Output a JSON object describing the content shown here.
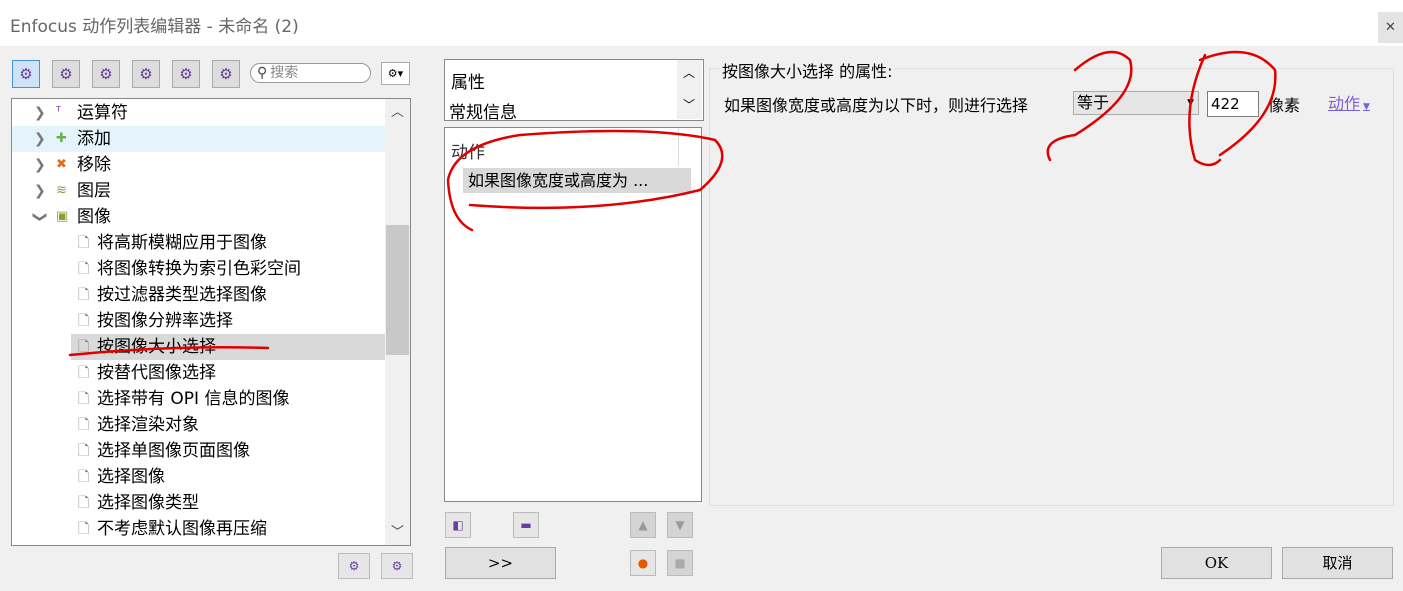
{
  "window": {
    "title": "Enfocus 动作列表编辑器 - 未命名 (2)",
    "close": "✕"
  },
  "toolbar": {
    "search_placeholder": "搜索",
    "icons": [
      "gear-all-icon",
      "gear-pointer-icon",
      "gear-refresh-icon",
      "gear-check-icon",
      "gear-info-icon",
      "gear-wrench-icon"
    ]
  },
  "tree": {
    "categories": [
      {
        "label": "运算符",
        "expanded": false,
        "icon_color": "#7a3d9a"
      },
      {
        "label": "添加",
        "expanded": false,
        "icon_color": "#6ab04c"
      },
      {
        "label": "移除",
        "expanded": false,
        "icon_color": "#e07020"
      },
      {
        "label": "图层",
        "expanded": false,
        "icon_color": "#8aa030"
      },
      {
        "label": "图像",
        "expanded": true,
        "icon_color": "#8aa030"
      }
    ],
    "items": [
      "将高斯模糊应用于图像",
      "将图像转换为索引色彩空间",
      "按过滤器类型选择图像",
      "按图像分辨率选择",
      "按图像大小选择",
      "按替代图像选择",
      "选择带有 OPI 信息的图像",
      "选择渲染对象",
      "选择单图像页面图像",
      "选择图像",
      "选择图像类型",
      "不考虑默认图像再压缩"
    ],
    "selected": "按图像大小选择"
  },
  "properties_list": {
    "items": [
      "属性",
      "常规信息"
    ]
  },
  "actions_list": {
    "header": "动作",
    "items": [
      "如果图像宽度或高度为 ..."
    ]
  },
  "middle_buttons": {
    "forward": ">>"
  },
  "properties": {
    "title": "按图像大小选择 的属性:",
    "label": "如果图像宽度或高度为以下时，则进行选择",
    "comparison": "等于",
    "value": "422",
    "unit": "像素",
    "action_link": "动作"
  },
  "dialog": {
    "ok": "OK",
    "cancel": "取消"
  },
  "colors": {
    "annotation": "#e00000",
    "link": "#7b5fd6"
  }
}
